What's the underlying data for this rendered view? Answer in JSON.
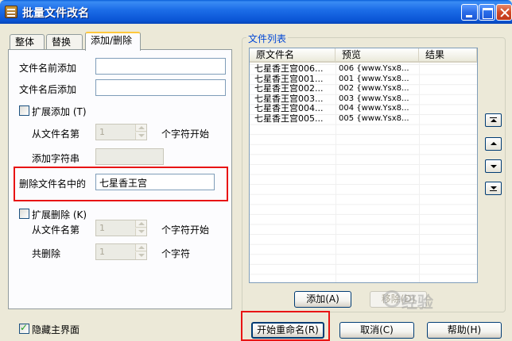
{
  "window": {
    "title": "批量文件改名"
  },
  "tabs": [
    {
      "label": "整体"
    },
    {
      "label": "替换"
    },
    {
      "label": "添加/删除"
    }
  ],
  "add_remove": {
    "prefix_label": "文件名前添加",
    "prefix_value": "",
    "suffix_label": "文件名后添加",
    "suffix_value": "",
    "extend_add": {
      "label": "扩展添加 (T)",
      "checked": false
    },
    "from_pos_label": "从文件名第",
    "from_pos_value": "1",
    "char_start_label": "个字符开始",
    "add_string_label": "添加字符串",
    "add_string_value": "",
    "delete_label": "删除文件名中的",
    "delete_value": "七星香王宫",
    "extend_delete": {
      "label": "扩展删除 (K)",
      "checked": false
    },
    "del_from_label": "从文件名第",
    "del_from_value": "1",
    "del_char_start_label": "个字符开始",
    "del_total_label": "共删除",
    "del_total_value": "1",
    "del_char_label": "个字符"
  },
  "file_list": {
    "title": "文件列表",
    "columns": [
      "原文件名",
      "预览",
      "结果"
    ],
    "rows": [
      {
        "original": "七星香王宫006...",
        "preview": "006 {www.Ysx8...",
        "result": ""
      },
      {
        "original": "七星香王宫001...",
        "preview": "001 {www.Ysx8...",
        "result": ""
      },
      {
        "original": "七星香王宫002...",
        "preview": "002 {www.Ysx8...",
        "result": ""
      },
      {
        "original": "七星香王宫003...",
        "preview": "003 {www.Ysx8...",
        "result": ""
      },
      {
        "original": "七星香王宫004...",
        "preview": "004 {www.Ysx8...",
        "result": ""
      },
      {
        "original": "七星香王宫005...",
        "preview": "005 {www.Ysx8...",
        "result": ""
      }
    ],
    "add_button": "添加(A)",
    "remove_button": "移除(D)"
  },
  "footer": {
    "hide_main": {
      "label": "隐藏主界面",
      "checked": true
    },
    "start_button": "开始重命名(R)",
    "cancel_button": "取消(C)",
    "help_button": "帮助(H)"
  },
  "watermark_text": "经验",
  "colors": {
    "highlight_frame": "#e81414",
    "titlebar": "#0a55d6",
    "group_title": "#0046d5"
  }
}
